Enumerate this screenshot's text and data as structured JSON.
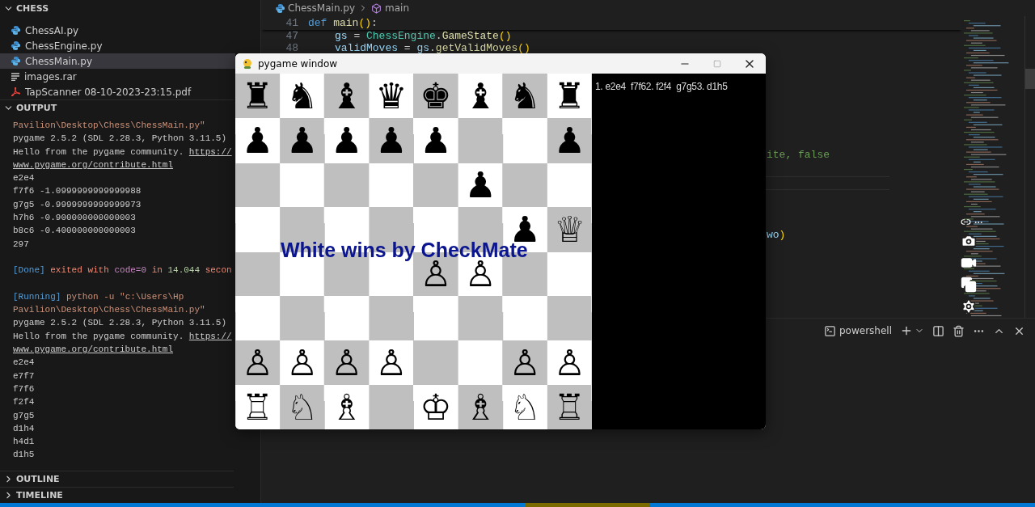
{
  "explorer": {
    "title": "CHESS",
    "expanded": true,
    "files": [
      {
        "name": "ChessAI.py",
        "kind": "python",
        "selected": false
      },
      {
        "name": "ChessEngine.py",
        "kind": "python",
        "selected": false
      },
      {
        "name": "ChessMain.py",
        "kind": "python",
        "selected": true
      },
      {
        "name": "images.rar",
        "kind": "archive",
        "selected": false
      },
      {
        "name": "TapScanner 08-10-2023-23:15.pdf",
        "kind": "pdf",
        "selected": false
      }
    ]
  },
  "output": {
    "title": "OUTPUT",
    "expanded": true,
    "lines": [
      {
        "kind": "text",
        "segments": [
          {
            "text": "Pavilion\\Desktop\\Chess\\ChessMain.py\"",
            "kind": "string"
          }
        ]
      },
      {
        "kind": "text",
        "segments": [
          {
            "text": "pygame 2.5.2 (SDL 2.28.3, Python 3.11.5)",
            "kind": "plain"
          }
        ]
      },
      {
        "kind": "text",
        "segments": [
          {
            "text": "Hello from the pygame community. ",
            "kind": "plain"
          },
          {
            "text": "https://",
            "kind": "link"
          }
        ]
      },
      {
        "kind": "text",
        "segments": [
          {
            "text": "www.pygame.org/contribute.html",
            "kind": "link"
          }
        ]
      },
      {
        "kind": "text",
        "segments": [
          {
            "text": "e2e4",
            "kind": "plain"
          }
        ]
      },
      {
        "kind": "text",
        "segments": [
          {
            "text": "f7f6 -1.0999999999999988",
            "kind": "plain"
          }
        ]
      },
      {
        "kind": "text",
        "segments": [
          {
            "text": "g7g5 -0.9999999999999973",
            "kind": "plain"
          }
        ]
      },
      {
        "kind": "text",
        "segments": [
          {
            "text": "h7h6 -0.900000000000003",
            "kind": "plain"
          }
        ]
      },
      {
        "kind": "text",
        "segments": [
          {
            "text": "b8c6 -0.400000000000003",
            "kind": "plain"
          }
        ]
      },
      {
        "kind": "text",
        "segments": [
          {
            "text": "297",
            "kind": "plain"
          }
        ]
      },
      {
        "kind": "blank"
      },
      {
        "kind": "text",
        "segments": [
          {
            "text": "[Done]",
            "kind": "tag"
          },
          {
            "text": " exited with ",
            "kind": "error"
          },
          {
            "text": "code=0",
            "kind": "keyword"
          },
          {
            "text": " in ",
            "kind": "error"
          },
          {
            "text": "14.044",
            "kind": "number"
          },
          {
            "text": " secon",
            "kind": "error"
          }
        ]
      },
      {
        "kind": "blank"
      },
      {
        "kind": "text",
        "segments": [
          {
            "text": "[Running]",
            "kind": "tag"
          },
          {
            "text": " python -u \"c:\\Users\\Hp",
            "kind": "string"
          }
        ]
      },
      {
        "kind": "text",
        "segments": [
          {
            "text": "Pavilion\\Desktop\\Chess\\ChessMain.py\"",
            "kind": "string"
          }
        ]
      },
      {
        "kind": "text",
        "segments": [
          {
            "text": "pygame 2.5.2 (SDL 2.28.3, Python 3.11.5)",
            "kind": "plain"
          }
        ]
      },
      {
        "kind": "text",
        "segments": [
          {
            "text": "Hello from the pygame community. ",
            "kind": "plain"
          },
          {
            "text": "https://",
            "kind": "link"
          }
        ]
      },
      {
        "kind": "text",
        "segments": [
          {
            "text": "www.pygame.org/contribute.html",
            "kind": "link"
          }
        ]
      },
      {
        "kind": "text",
        "segments": [
          {
            "text": "e2e4",
            "kind": "plain"
          }
        ]
      },
      {
        "kind": "text",
        "segments": [
          {
            "text": "e7f7",
            "kind": "plain"
          }
        ]
      },
      {
        "kind": "text",
        "segments": [
          {
            "text": "f7f6",
            "kind": "plain"
          }
        ]
      },
      {
        "kind": "text",
        "segments": [
          {
            "text": "f2f4",
            "kind": "plain"
          }
        ]
      },
      {
        "kind": "text",
        "segments": [
          {
            "text": "g7g5",
            "kind": "plain"
          }
        ]
      },
      {
        "kind": "text",
        "segments": [
          {
            "text": "d1h4",
            "kind": "plain"
          }
        ]
      },
      {
        "kind": "text",
        "segments": [
          {
            "text": "h4d1",
            "kind": "plain"
          }
        ]
      },
      {
        "kind": "text",
        "segments": [
          {
            "text": "d1h5",
            "kind": "plain"
          }
        ]
      }
    ]
  },
  "outline": {
    "title": "OUTLINE",
    "expanded": false
  },
  "timeline": {
    "title": "TIMELINE",
    "expanded": false
  },
  "breadcrumbs": [
    {
      "text": "ChessMain.py",
      "kind": "file"
    },
    {
      "text": "main",
      "kind": "symbol"
    }
  ],
  "code_lines": [
    {
      "number": "41",
      "kind": "sticky",
      "tokens": [
        {
          "text": "def ",
          "kind": "keyword"
        },
        {
          "text": "main",
          "kind": "function"
        },
        {
          "text": "()",
          "kind": "bracket"
        },
        {
          "text": ":",
          "kind": "plain"
        }
      ]
    },
    {
      "number": "47",
      "kind": "body",
      "tokens": [
        {
          "text": "gs",
          "kind": "variable"
        },
        {
          "text": " = ",
          "kind": "plain"
        },
        {
          "text": "ChessEngine",
          "kind": "class"
        },
        {
          "text": ".",
          "kind": "plain"
        },
        {
          "text": "GameState",
          "kind": "function"
        },
        {
          "text": "()",
          "kind": "bracket"
        }
      ]
    },
    {
      "number": "48",
      "kind": "body",
      "tokens": [
        {
          "text": "validMoves",
          "kind": "variable"
        },
        {
          "text": " = ",
          "kind": "plain"
        },
        {
          "text": "gs",
          "kind": "variable"
        },
        {
          "text": ".",
          "kind": "plain"
        },
        {
          "text": "getValidMoves",
          "kind": "function"
        },
        {
          "text": "()",
          "kind": "bracket"
        }
      ]
    }
  ],
  "code_fragments": [
    {
      "tokens": [
        {
          "text": "ite, false",
          "kind": "comment"
        }
      ]
    },
    {
      "tokens": [
        {
          "text": "wo",
          "kind": "variable"
        },
        {
          "text": ")",
          "kind": "bracket"
        }
      ]
    }
  ],
  "terminal": {
    "shell": "powershell"
  },
  "pygame_window": {
    "title": "pygame window",
    "ranks": [
      {
        "squares": [
          {
            "kind": "piece",
            "glyph": "♜"
          },
          {
            "kind": "piece",
            "glyph": "♞"
          },
          {
            "kind": "piece",
            "glyph": "♝"
          },
          {
            "kind": "piece",
            "glyph": "♛"
          },
          {
            "kind": "piece",
            "glyph": "♚"
          },
          {
            "kind": "piece",
            "glyph": "♝"
          },
          {
            "kind": "piece",
            "glyph": "♞"
          },
          {
            "kind": "piece",
            "glyph": "♜"
          }
        ]
      },
      {
        "squares": [
          {
            "kind": "piece",
            "glyph": "♟"
          },
          {
            "kind": "piece",
            "glyph": "♟"
          },
          {
            "kind": "piece",
            "glyph": "♟"
          },
          {
            "kind": "piece",
            "glyph": "♟"
          },
          {
            "kind": "piece",
            "glyph": "♟"
          },
          {
            "kind": "empty"
          },
          {
            "kind": "empty"
          },
          {
            "kind": "piece",
            "glyph": "♟"
          }
        ]
      },
      {
        "squares": [
          {
            "kind": "empty"
          },
          {
            "kind": "empty"
          },
          {
            "kind": "empty"
          },
          {
            "kind": "empty"
          },
          {
            "kind": "empty"
          },
          {
            "kind": "piece",
            "glyph": "♟"
          },
          {
            "kind": "empty"
          },
          {
            "kind": "empty"
          }
        ]
      },
      {
        "squares": [
          {
            "kind": "empty"
          },
          {
            "kind": "empty"
          },
          {
            "kind": "empty"
          },
          {
            "kind": "empty"
          },
          {
            "kind": "empty"
          },
          {
            "kind": "empty"
          },
          {
            "kind": "piece",
            "glyph": "♟"
          },
          {
            "kind": "piece",
            "glyph": "♕"
          }
        ]
      },
      {
        "squares": [
          {
            "kind": "empty"
          },
          {
            "kind": "empty"
          },
          {
            "kind": "empty"
          },
          {
            "kind": "empty"
          },
          {
            "kind": "piece",
            "glyph": "♙"
          },
          {
            "kind": "piece",
            "glyph": "♙"
          },
          {
            "kind": "empty"
          },
          {
            "kind": "empty"
          }
        ]
      },
      {
        "squares": [
          {
            "kind": "empty"
          },
          {
            "kind": "empty"
          },
          {
            "kind": "empty"
          },
          {
            "kind": "empty"
          },
          {
            "kind": "empty"
          },
          {
            "kind": "empty"
          },
          {
            "kind": "empty"
          },
          {
            "kind": "empty"
          }
        ]
      },
      {
        "squares": [
          {
            "kind": "piece",
            "glyph": "♙"
          },
          {
            "kind": "piece",
            "glyph": "♙"
          },
          {
            "kind": "piece",
            "glyph": "♙"
          },
          {
            "kind": "piece",
            "glyph": "♙"
          },
          {
            "kind": "empty"
          },
          {
            "kind": "empty"
          },
          {
            "kind": "piece",
            "glyph": "♙"
          },
          {
            "kind": "piece",
            "glyph": "♙"
          }
        ]
      },
      {
        "squares": [
          {
            "kind": "piece",
            "glyph": "♖"
          },
          {
            "kind": "piece",
            "glyph": "♘"
          },
          {
            "kind": "piece",
            "glyph": "♗"
          },
          {
            "kind": "empty"
          },
          {
            "kind": "piece",
            "glyph": "♔"
          },
          {
            "kind": "piece",
            "glyph": "♗"
          },
          {
            "kind": "piece",
            "glyph": "♘"
          },
          {
            "kind": "piece",
            "glyph": "♖"
          }
        ]
      }
    ],
    "message": "White wins by CheckMate",
    "move_log": "1. e2e4  f7f62. f2f4  g7g53. d1h5"
  }
}
